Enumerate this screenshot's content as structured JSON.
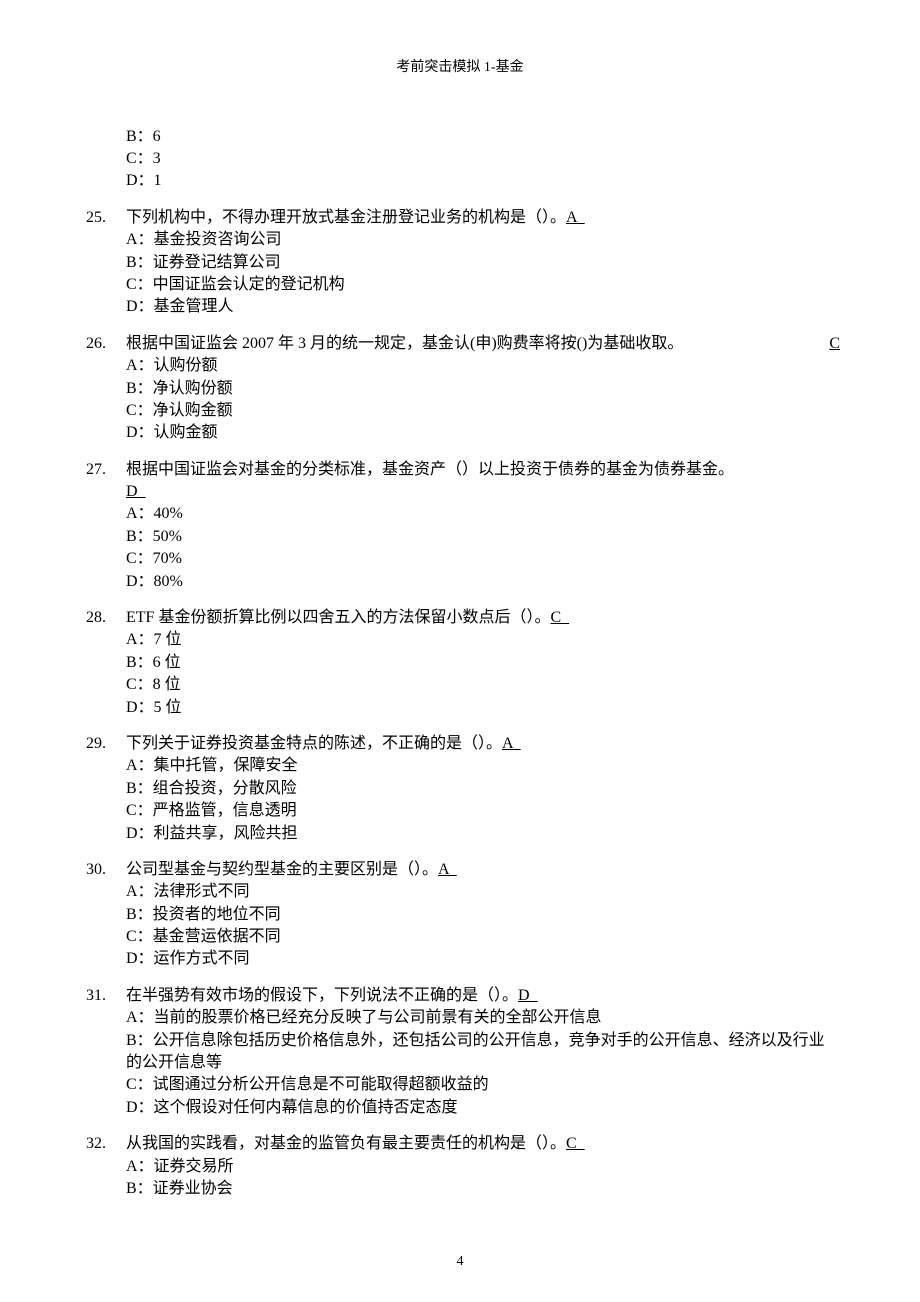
{
  "header": {
    "title": "考前突击模拟 1-基金"
  },
  "pageNumber": "4",
  "partialOptions": {
    "b": "B：6",
    "c": "C：3",
    "d": "D：1"
  },
  "questions": [
    {
      "number": "25.",
      "text": "下列机构中，不得办理开放式基金注册登记业务的机构是（）。",
      "answer": "A  ",
      "answerPosition": "inline",
      "options": [
        "A：基金投资咨询公司",
        "B：证券登记结算公司",
        "C：中国证监会认定的登记机构",
        "D：基金管理人"
      ]
    },
    {
      "number": "26.",
      "text": "根据中国证监会 2007 年 3 月的统一规定，基金认(申)购费率将按()为基础收取。",
      "answer": "C",
      "answerPosition": "right",
      "options": [
        "A：认购份额",
        "B：净认购份额",
        "C：净认购金额",
        "D：认购金额"
      ]
    },
    {
      "number": "27.",
      "text": "根据中国证监会对基金的分类标准，基金资产（）以上投资于债券的基金为债券基金。",
      "answer": "D  ",
      "answerPosition": "nextline",
      "options": [
        "A：40%",
        "B：50%",
        "C：70%",
        "D：80%"
      ]
    },
    {
      "number": "28.",
      "text": "ETF 基金份额折算比例以四舍五入的方法保留小数点后（）。",
      "answer": "C  ",
      "answerPosition": "inline",
      "options": [
        "A：7 位",
        "B：6 位",
        "C：8 位",
        "D：5 位"
      ]
    },
    {
      "number": "29.",
      "text": "下列关于证券投资基金特点的陈述，不正确的是（）。",
      "answer": "A  ",
      "answerPosition": "inline",
      "options": [
        "A：集中托管，保障安全",
        "B：组合投资，分散风险",
        "C：严格监管，信息透明",
        "D：利益共享，风险共担"
      ]
    },
    {
      "number": "30.",
      "text": "公司型基金与契约型基金的主要区别是（）。",
      "answer": "A  ",
      "answerPosition": "inline",
      "options": [
        "A：法律形式不同",
        "B：投资者的地位不同",
        "C：基金营运依据不同",
        "D：运作方式不同"
      ]
    },
    {
      "number": "31.",
      "text": "在半强势有效市场的假设下，下列说法不正确的是（）。",
      "answer": "D  ",
      "answerPosition": "inline",
      "options": [
        "A：当前的股票价格已经充分反映了与公司前景有关的全部公开信息",
        "B：公开信息除包括历史价格信息外，还包括公司的公开信息，竞争对手的公开信息、经济以及行业的公开信息等",
        "C：试图通过分析公开信息是不可能取得超额收益的",
        "D：这个假设对任何内幕信息的价值持否定态度"
      ]
    },
    {
      "number": "32.",
      "text": "从我国的实践看，对基金的监管负有最主要责任的机构是（）。",
      "answer": "C  ",
      "answerPosition": "inline",
      "options": [
        "A：证券交易所",
        "B：证券业协会"
      ]
    }
  ]
}
